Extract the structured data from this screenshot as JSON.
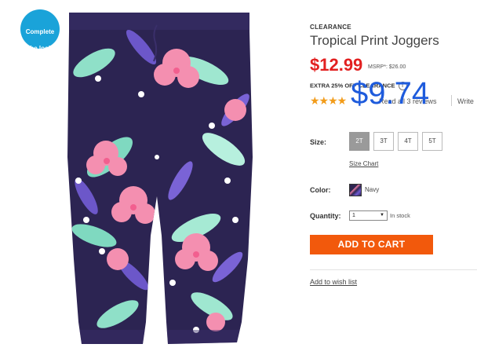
{
  "promo": {
    "line1": "Complete",
    "line2": "the look",
    "chevron": "⌄"
  },
  "product": {
    "badge": "CLEARANCE",
    "title": "Tropical Print Joggers",
    "price": "$12.99",
    "msrp": "MSRP*: $26.00",
    "extra_offer": "EXTRA 25% OFF CLEARANCE",
    "info_icon": "i",
    "stars": "★★★★",
    "read_all": "Read all",
    "reviews": "3 reviews",
    "write": "Write",
    "overlay_price": "$9.74"
  },
  "size": {
    "label": "Size:",
    "options": [
      "2T",
      "3T",
      "4T",
      "5T"
    ],
    "selected": "2T",
    "chart_link": "Size Chart"
  },
  "color": {
    "label": "Color:",
    "value": "Navy"
  },
  "quantity": {
    "label": "Quantity:",
    "value": "1",
    "stock": "In stock"
  },
  "actions": {
    "add_to_cart": "ADD TO CART",
    "wishlist": "Add to wish list"
  },
  "colors": {
    "accent_orange": "#f2590c",
    "price_red": "#e22020",
    "promo_blue": "#1aa3d9",
    "overlay_blue": "#1e5bdc"
  }
}
